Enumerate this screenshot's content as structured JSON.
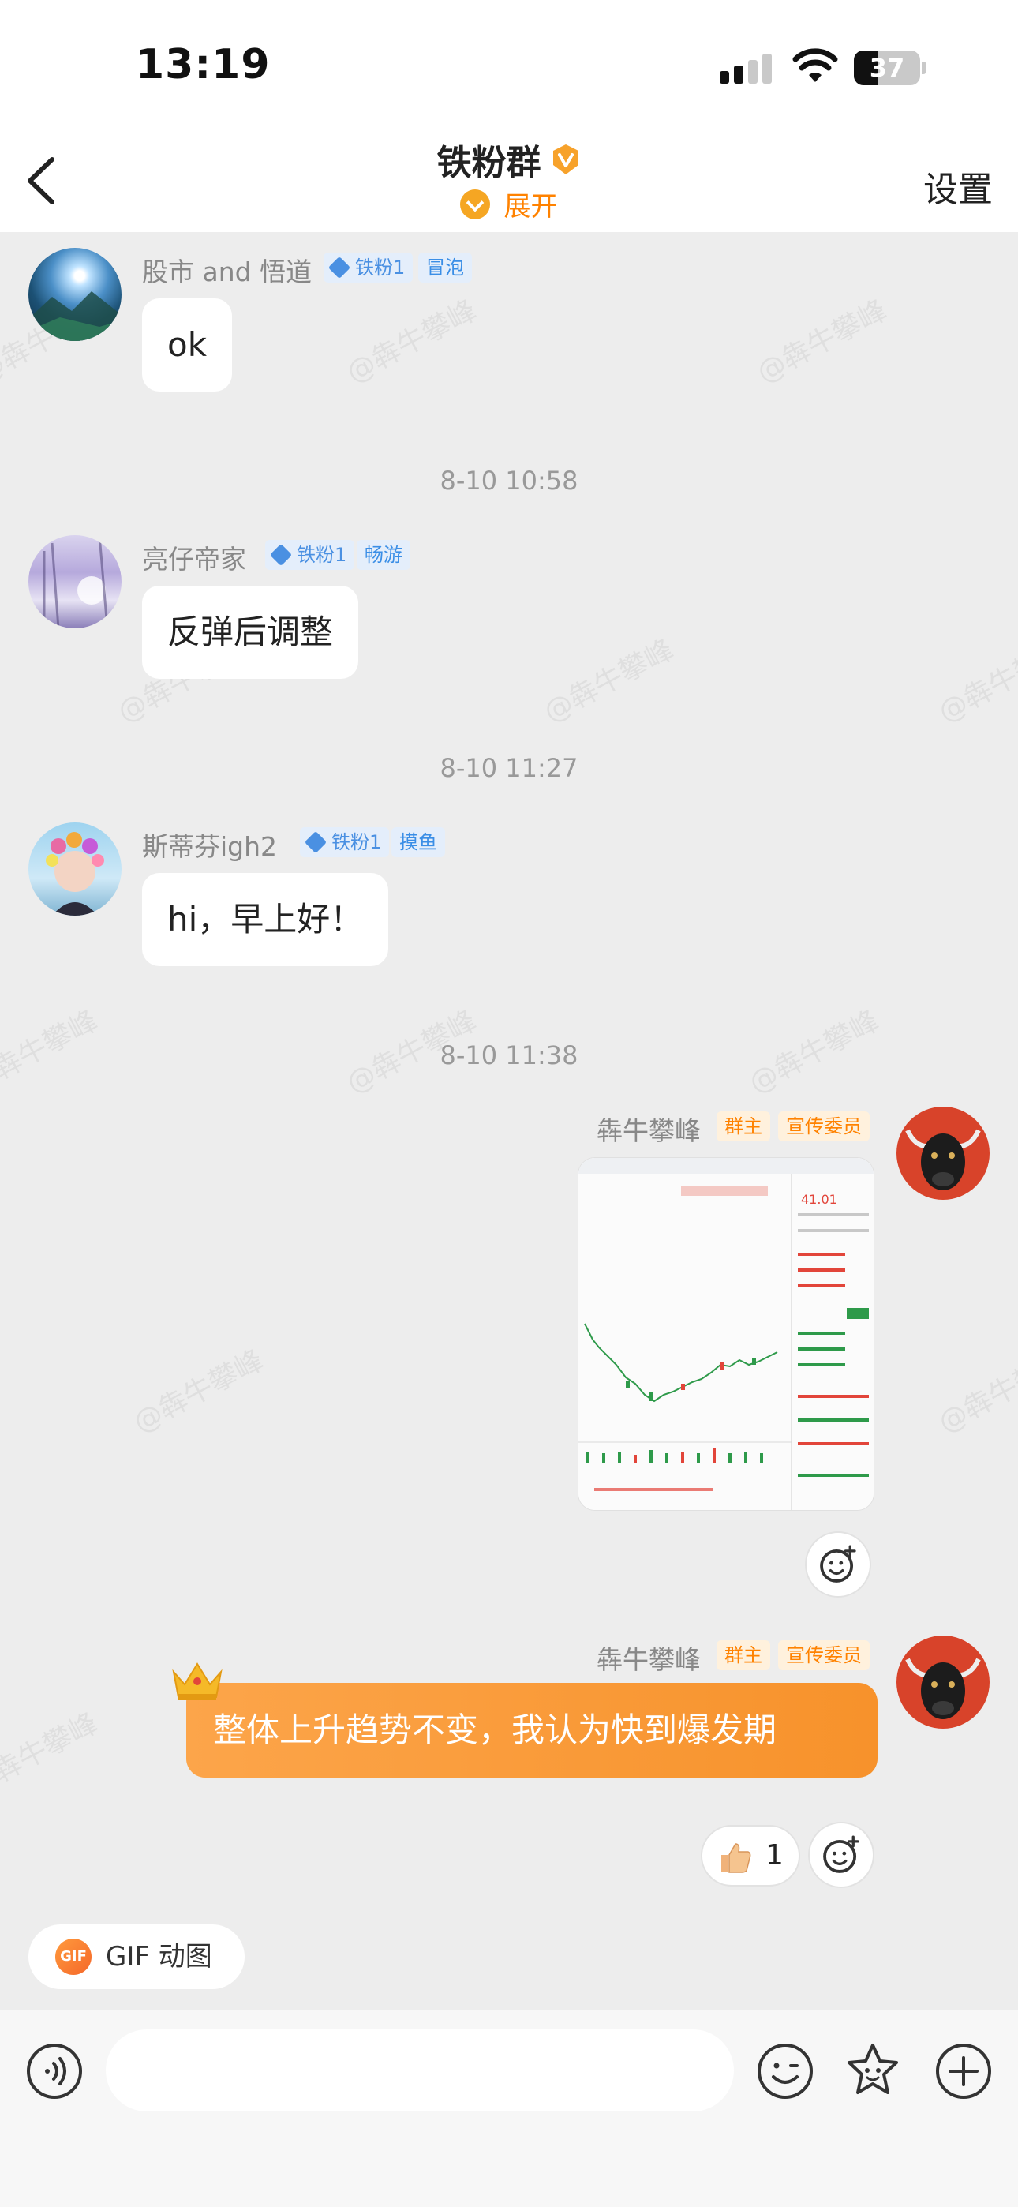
{
  "status_bar": {
    "time": "13:19",
    "battery": "37",
    "battery_level": 0.37
  },
  "header": {
    "title": "铁粉群",
    "expand_label": "展开",
    "settings_label": "设置"
  },
  "watermark": "@犇牛攀峰",
  "messages": [
    {
      "sender": "股市 and 悟道",
      "fan_tag": "铁粉1",
      "role_tag": "冒泡",
      "text": "ok"
    },
    {
      "timestamp": "8-10 10:58"
    },
    {
      "sender": "亮仔帝家",
      "fan_tag": "铁粉1",
      "role_tag": "畅游",
      "text": "反弹后调整"
    },
    {
      "timestamp": "8-10 11:27"
    },
    {
      "sender": "斯蒂芬igh2",
      "fan_tag": "铁粉1",
      "role_tag": "摸鱼",
      "text": "hi，早上好！"
    },
    {
      "timestamp": "8-10 11:38"
    },
    {
      "sender": "犇牛攀峰",
      "owner_tag": "群主",
      "role_tag": "宣传委员",
      "image_price": "41.01"
    },
    {
      "sender": "犇牛攀峰",
      "owner_tag": "群主",
      "role_tag": "宣传委员",
      "text": "整体上升趋势不变，我认为快到爆发期",
      "like_count": "1"
    }
  ],
  "gif_button": {
    "icon_text": "GIF",
    "label": "GIF 动图"
  },
  "colors": {
    "accent": "#ff8200",
    "bubble_orange": "#f7922b",
    "fan_tag": "#4a90e2"
  }
}
